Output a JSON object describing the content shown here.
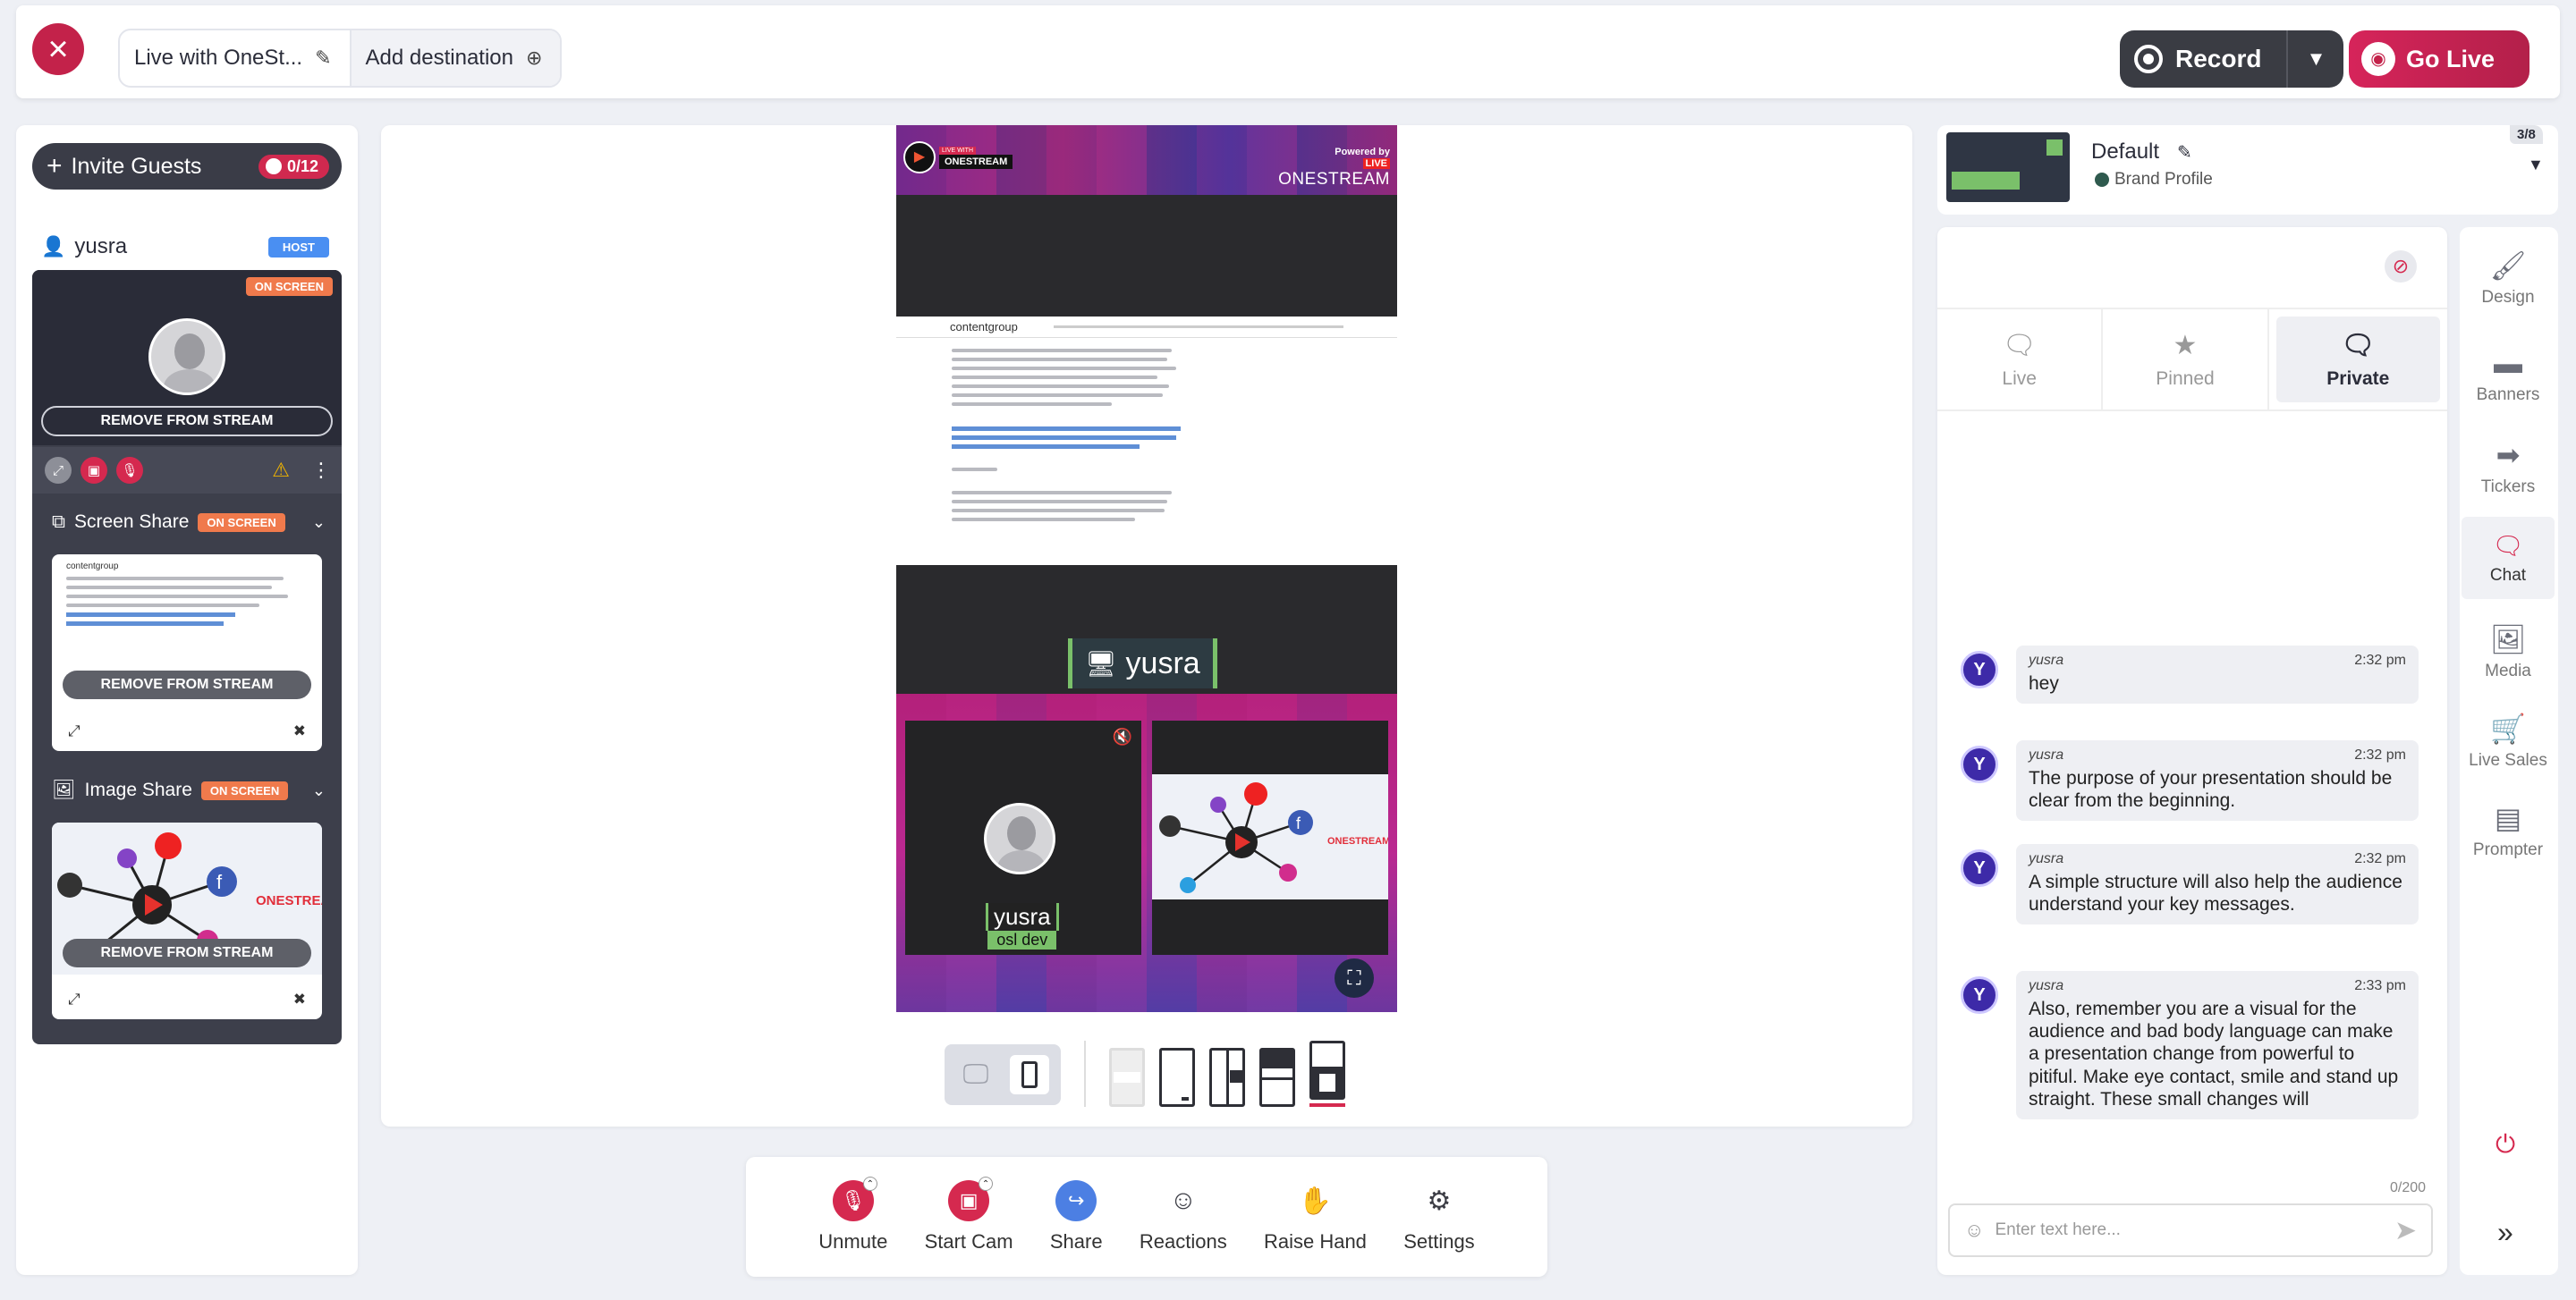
{
  "topbar": {
    "destination_name": "Live with OneSt...",
    "add_destination": "Add destination",
    "record_label": "Record",
    "golive_label": "Go Live"
  },
  "left": {
    "invite_label": "Invite Guests",
    "invite_count": "0/12",
    "host_name": "yusra",
    "host_badge": "HOST",
    "on_screen": "ON SCREEN",
    "remove_label": "REMOVE FROM STREAM",
    "screen_share_label": "Screen Share",
    "image_share_label": "Image Share"
  },
  "canvas": {
    "live_with": "LIVE WITH",
    "brand": "ONESTREAM",
    "powered_by": "Powered by",
    "live_tag": "LIVE",
    "brand_big": "ONESTREAM",
    "doc_brand": "contentgroup",
    "screen_name": "yusra",
    "cam_name": "yusra",
    "cam_subtitle": "osl dev"
  },
  "controls": {
    "unmute": "Unmute",
    "start_cam": "Start Cam",
    "share": "Share",
    "reactions": "Reactions",
    "raise_hand": "Raise Hand",
    "settings": "Settings"
  },
  "brand_profile": {
    "counter": "3/8",
    "name": "Default",
    "sub": "Brand Profile"
  },
  "chat": {
    "tabs": [
      "Live",
      "Pinned",
      "Private"
    ],
    "messages": [
      {
        "user": "yusra",
        "time": "2:32 pm",
        "text": "hey"
      },
      {
        "user": "yusra",
        "time": "2:32 pm",
        "text": "The purpose of your presentation should be clear from the beginning."
      },
      {
        "user": "yusra",
        "time": "2:32 pm",
        "text": "A simple structure will also help the audience understand your key messages."
      },
      {
        "user": "yusra",
        "time": "2:33 pm",
        "text": "Also, remember you are a visual for the audience and bad body language can make a presentation change from powerful to pitiful. Make eye contact, smile and stand up straight. These small changes will"
      }
    ],
    "avatar_letter": "Y",
    "char_count": "0/200",
    "placeholder": "Enter text here..."
  },
  "sidenav": [
    "Design",
    "Banners",
    "Tickers",
    "Chat",
    "Media",
    "Live Sales",
    "Prompter"
  ],
  "colors": {
    "accent": "#c3224a",
    "onscreen": "#f07a4c",
    "host_badge": "#4a8ff2",
    "chat_avatar": "#3d2aa8"
  }
}
